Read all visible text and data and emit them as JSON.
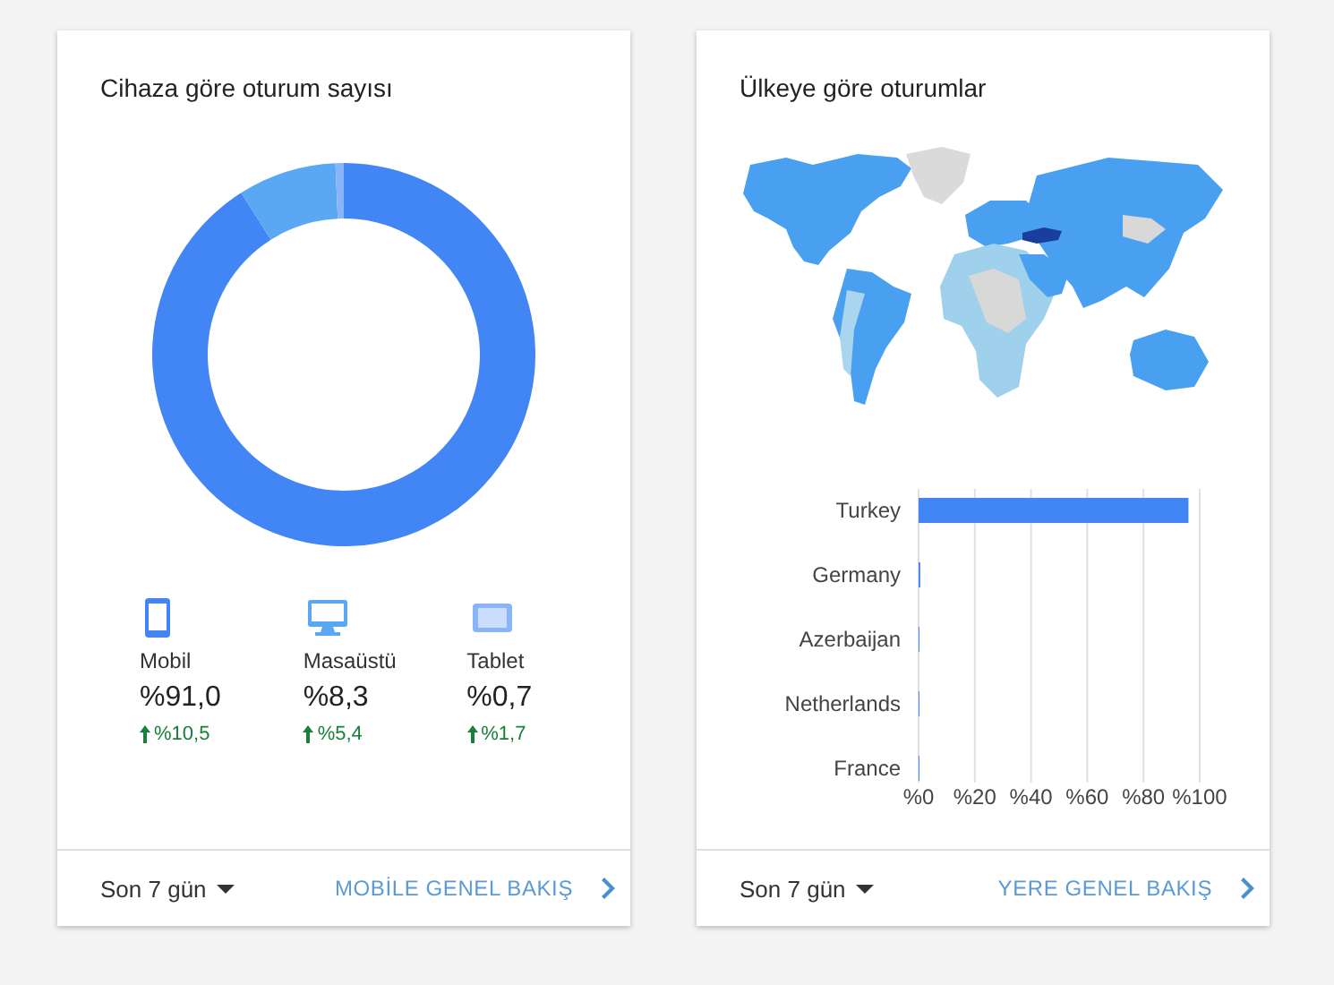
{
  "cards": [
    {
      "kind": "devices",
      "title": "Cihaza göre oturum sayısı",
      "chart_data": {
        "type": "donut",
        "values": [
          91.0,
          8.3,
          0.7
        ]
      },
      "devices": [
        {
          "kind": "phone",
          "label": "Mobil",
          "value": "%91,0",
          "change": "%10,5",
          "color": "#4285f4"
        },
        {
          "kind": "monitor",
          "label": "Masaüstü",
          "value": "%8,3",
          "change": "%5,4",
          "color": "#5aa7f3"
        },
        {
          "kind": "tablet",
          "label": "Tablet",
          "value": "%0,7",
          "change": "%1,7",
          "color": "#8ab4f8"
        }
      ],
      "period": "Son 7 gün",
      "link": "MOBİLE GENEL BAKIŞ"
    },
    {
      "kind": "countries",
      "title": "Ülkeye göre oturumlar",
      "chart_data": {
        "type": "bar",
        "orientation": "horizontal",
        "categories": [
          "Turkey",
          "Germany",
          "Azerbaijan",
          "Netherlands",
          "France"
        ],
        "values": [
          96,
          0.6,
          0.1,
          0.1,
          0.1
        ],
        "xlim": [
          0,
          100
        ],
        "grid": true,
        "xticks": [
          {
            "value": 0,
            "label": "%0"
          },
          {
            "value": 20,
            "label": "%20"
          },
          {
            "value": 40,
            "label": "%40"
          },
          {
            "value": 60,
            "label": "%60"
          },
          {
            "value": 80,
            "label": "%80"
          },
          {
            "value": 100,
            "label": "%100"
          }
        ]
      },
      "period": "Son 7 gün",
      "link": "YERE GENEL BAKIŞ"
    }
  ]
}
